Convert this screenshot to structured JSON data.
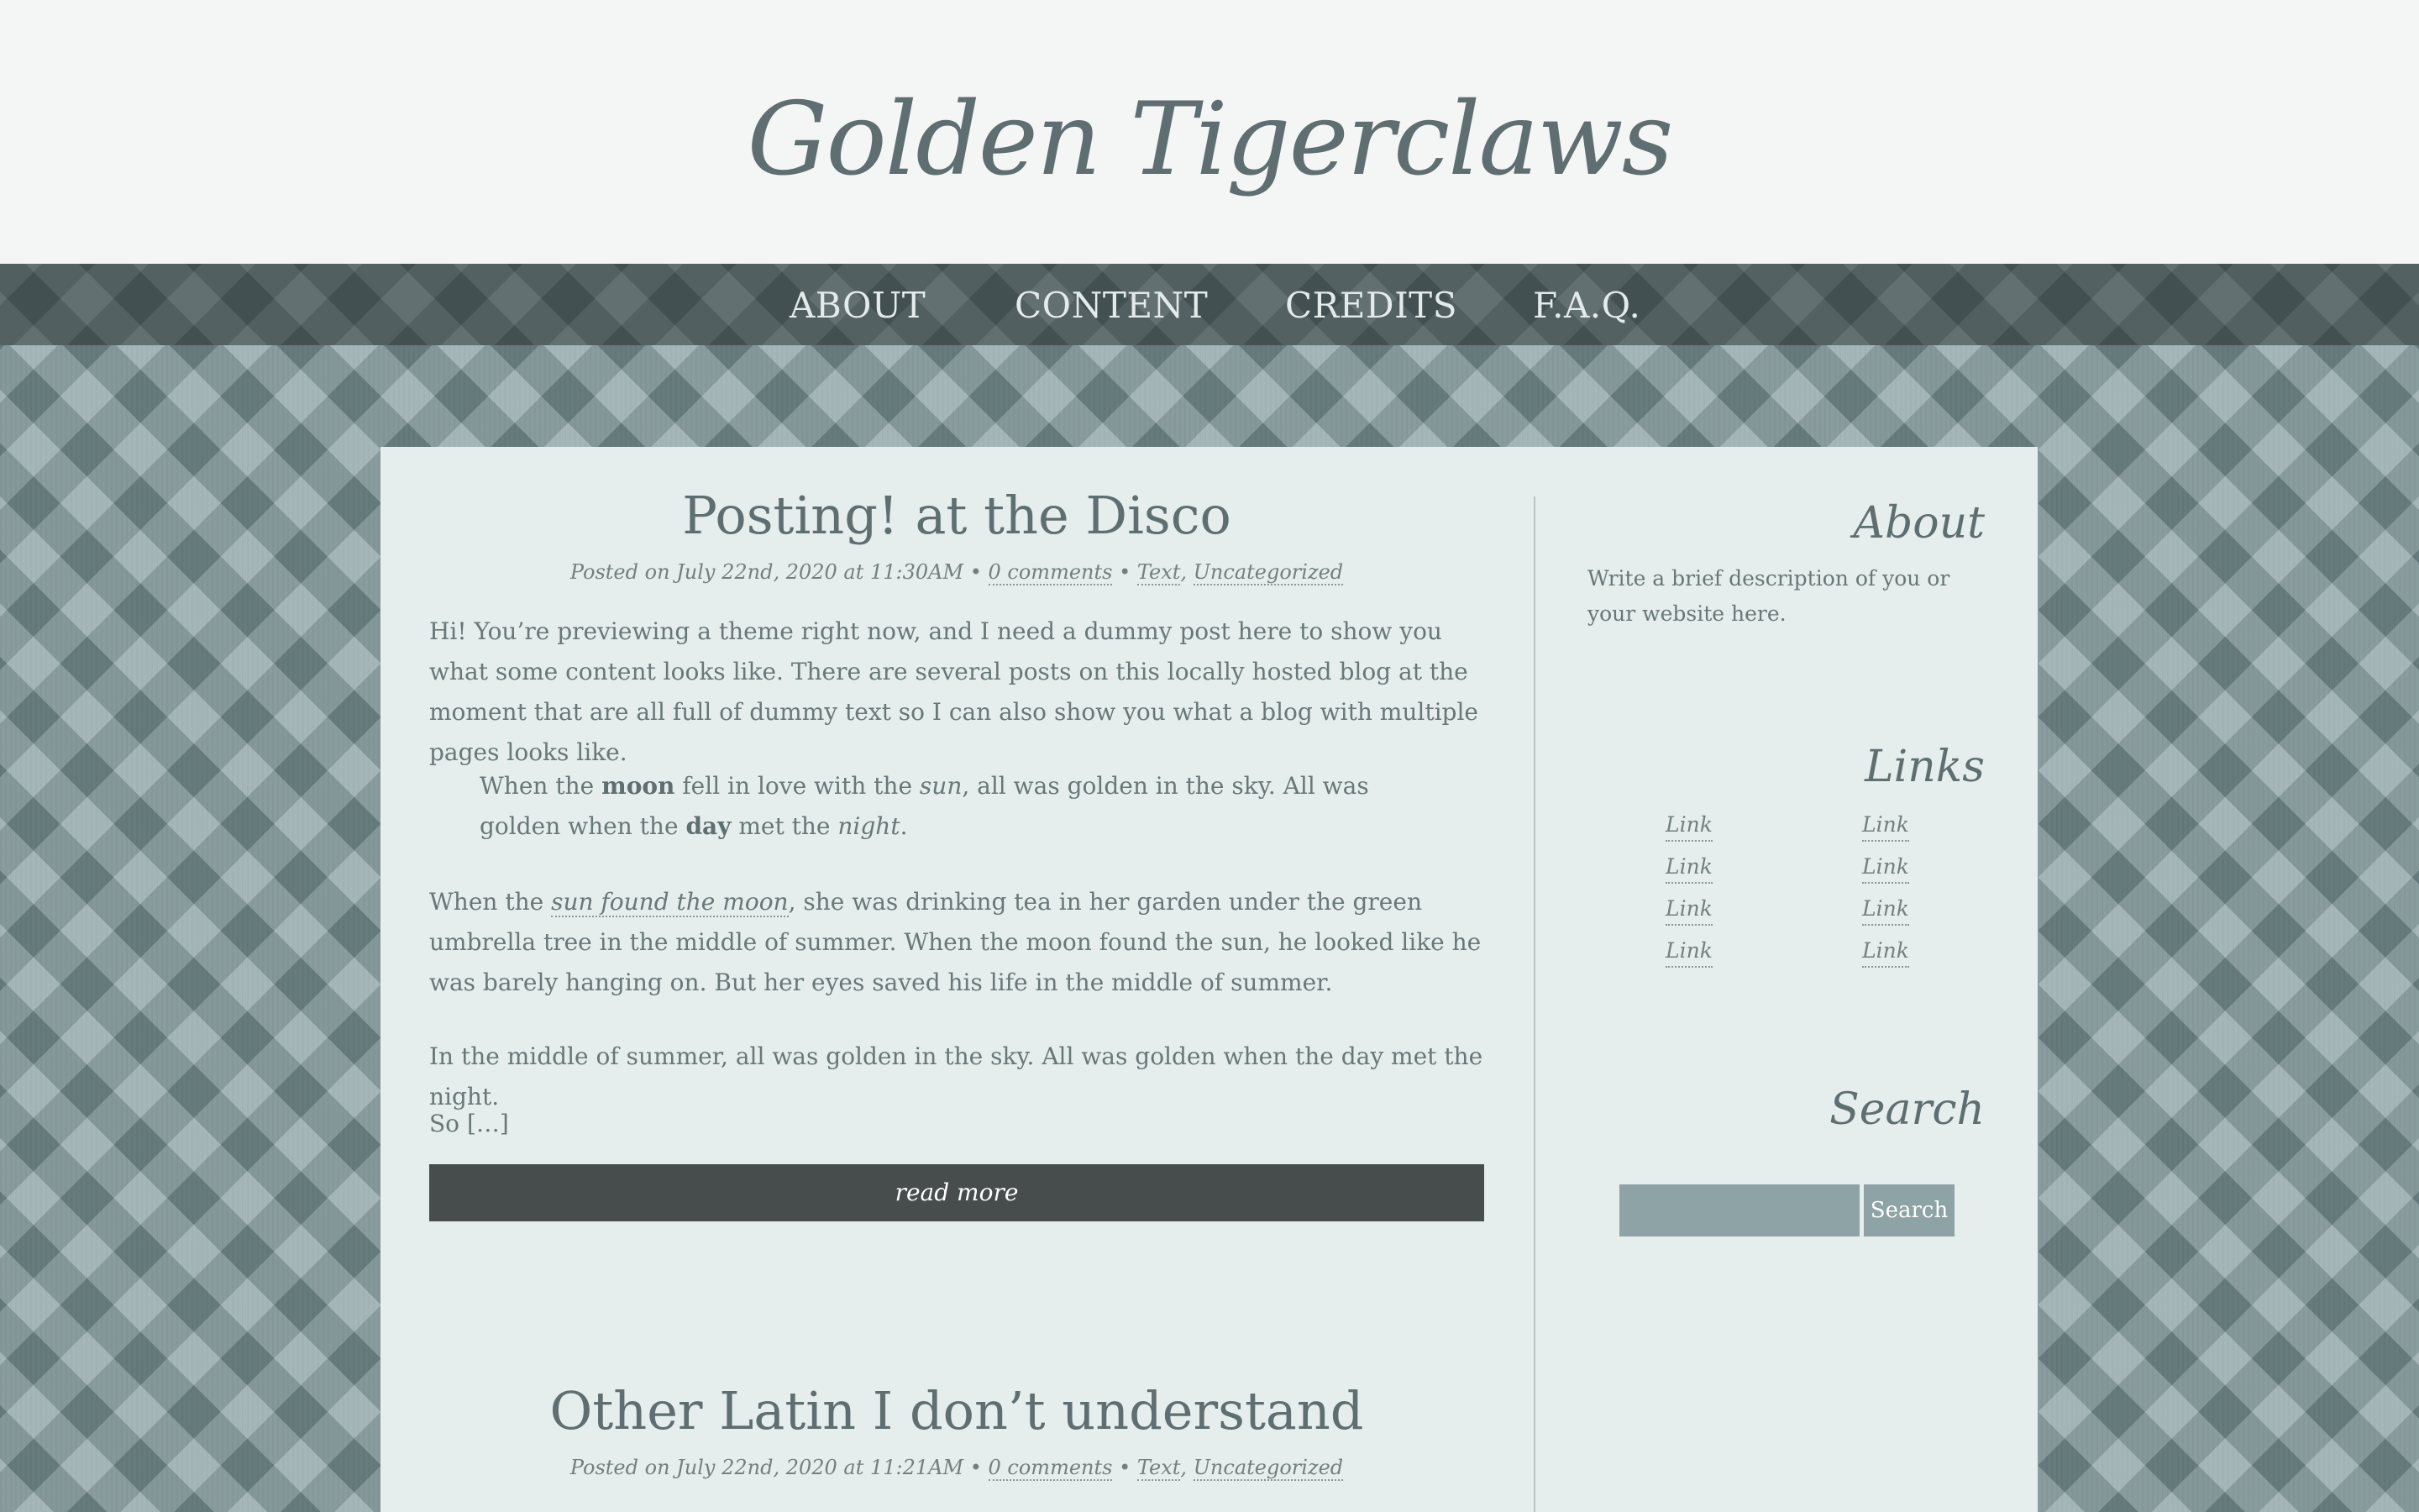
{
  "site": {
    "title": "Golden Tigerclaws"
  },
  "nav": {
    "items": [
      "ABOUT",
      "CONTENT",
      "CREDITS",
      "F.A.Q."
    ]
  },
  "posts": [
    {
      "title": "Posting! at the Disco",
      "meta": {
        "prefix": "Posted on July 22nd, 2020 at 11:30AM •",
        "comments": "0 comments",
        "separator": "•",
        "tag1": "Text",
        "comma": ",",
        "tag2": "Uncategorized"
      },
      "paragraph1": "Hi! You’re previewing a theme right now, and I need a dummy post here to show you what some content looks like. There are several posts on this locally hosted blog at the moment that are all full of dummy text so I can also show you what a blog with multiple pages looks like.",
      "quote": {
        "t1": "When the ",
        "b1": "moon",
        "t2": " fell in love with the ",
        "i1": "sun",
        "t3": ", all was golden in the sky. All was golden when the ",
        "b2": "day",
        "t4": " met the ",
        "i2": "night",
        "t5": "."
      },
      "paragraph2": {
        "before": "When the ",
        "link": "sun found the moon",
        "after": ", she was drinking tea in her garden under the green umbrella tree in the middle of summer. When the moon found the sun, he looked like he was barely hanging on. But her eyes saved his life in the middle of summer."
      },
      "paragraph3": "In the middle of summer, all was golden in the sky. All was golden when the day met the night.",
      "paragraph4": "So […]",
      "read_more": "read more"
    },
    {
      "title": "Other Latin I don’t understand",
      "meta": {
        "prefix": "Posted on July 22nd, 2020 at 11:21AM •",
        "comments": "0 comments",
        "separator": "•",
        "tag1": "Text",
        "comma": ",",
        "tag2": "Uncategorized"
      }
    }
  ],
  "sidebar": {
    "about": {
      "heading": "About",
      "text": "Write a brief description of you or your website here."
    },
    "links": {
      "heading": "Links",
      "items": [
        "Link",
        "Link",
        "Link",
        "Link",
        "Link",
        "Link",
        "Link",
        "Link"
      ]
    },
    "search": {
      "heading": "Search",
      "placeholder": "",
      "button": "Search"
    }
  }
}
